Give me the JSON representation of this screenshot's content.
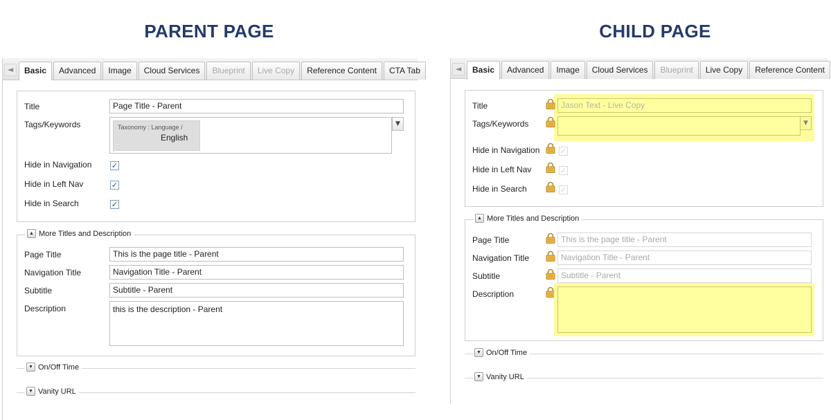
{
  "headings": {
    "parent": "PARENT PAGE",
    "child": "CHILD PAGE"
  },
  "parent": {
    "tabs": [
      "Basic",
      "Advanced",
      "Image",
      "Cloud Services",
      "Blueprint",
      "Live Copy",
      "Reference Content",
      "CTA Tab"
    ],
    "labels": {
      "title": "Title",
      "tags": "Tags/Keywords",
      "hide_nav": "Hide in Navigation",
      "hide_left_nav": "Hide in Left Nav",
      "hide_search": "Hide in Search",
      "page_title": "Page Title",
      "nav_title": "Navigation Title",
      "subtitle": "Subtitle",
      "description": "Description"
    },
    "values": {
      "title": "Page Title - Parent",
      "tag_namespace": "Taxonomy : Language /",
      "tag_value": "English",
      "page_title": "This is the page title - Parent",
      "nav_title": "Navigation Title - Parent",
      "subtitle": "Subtitle - Parent",
      "description": "this is the description - Parent"
    },
    "checks": {
      "hide_nav": "✓",
      "hide_left_nav": "✓",
      "hide_search": "✓"
    },
    "sections": {
      "more": "More Titles and Description",
      "onoff": "On/Off Time",
      "vanity": "Vanity URL"
    }
  },
  "child": {
    "tabs": [
      "Basic",
      "Advanced",
      "Image",
      "Cloud Services",
      "Blueprint",
      "Live Copy",
      "Reference Content"
    ],
    "labels": {
      "title": "Title",
      "tags": "Tags/Keywords",
      "hide_nav": "Hide in Navigation",
      "hide_left_nav": "Hide in Left Nav",
      "hide_search": "Hide in Search",
      "page_title": "Page Title",
      "nav_title": "Navigation Title",
      "subtitle": "Subtitle",
      "description": "Description"
    },
    "values": {
      "title": "Jason Text - Live Copy",
      "page_title": "This is the page title - Parent",
      "nav_title": "Navigation Title - Parent",
      "subtitle": "Subtitle - Parent"
    },
    "checks": {
      "hide_nav": "✓",
      "hide_left_nav": "✓",
      "hide_search": "✓"
    },
    "sections": {
      "more": "More Titles and Description",
      "onoff": "On/Off Time",
      "vanity": "Vanity URL"
    }
  },
  "colors": {
    "heading": "#243a6b",
    "highlight": "#fffb9e",
    "lock": "#e0a63a"
  },
  "icons": {
    "back": "left-arrow-icon",
    "lock": "lock-icon",
    "expand": "expand-toggle-icon",
    "collapse": "collapse-toggle-icon",
    "dropdown": "chevron-down-icon"
  },
  "glyphs": {
    "back": "◄",
    "up": "▲",
    "down": "▼"
  }
}
